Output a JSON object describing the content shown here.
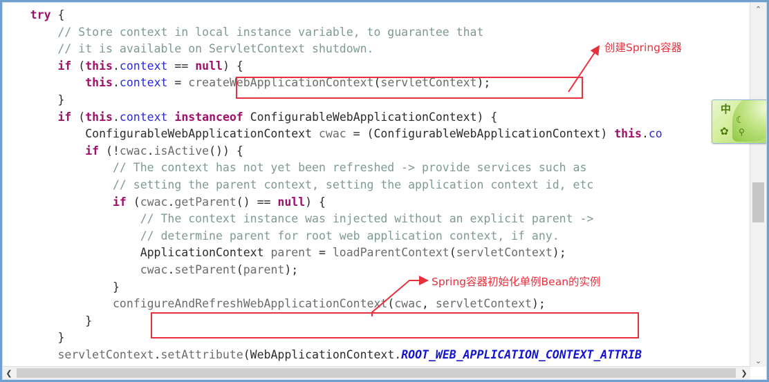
{
  "editor": {
    "language": "java",
    "code_lines": [
      {
        "id": "l1",
        "indent": 1,
        "text": "try {"
      },
      {
        "id": "l2",
        "indent": 2,
        "text": "// Store context in local instance variable, to guarantee that"
      },
      {
        "id": "l3",
        "indent": 2,
        "text": "// it is available on ServletContext shutdown."
      },
      {
        "id": "l4",
        "indent": 2,
        "text": "if (this.context == null) {"
      },
      {
        "id": "l5",
        "indent": 3,
        "text": "this.context = createWebApplicationContext(servletContext);"
      },
      {
        "id": "l6",
        "indent": 2,
        "text": "}"
      },
      {
        "id": "l7",
        "indent": 2,
        "text": "if (this.context instanceof ConfigurableWebApplicationContext) {"
      },
      {
        "id": "l8",
        "indent": 3,
        "text": "ConfigurableWebApplicationContext cwac = (ConfigurableWebApplicationContext) this.co"
      },
      {
        "id": "l9",
        "indent": 3,
        "text": "if (!cwac.isActive()) {"
      },
      {
        "id": "l10",
        "indent": 4,
        "text": "// The context has not yet been refreshed -> provide services such as"
      },
      {
        "id": "l11",
        "indent": 4,
        "text": "// setting the parent context, setting the application context id, etc"
      },
      {
        "id": "l12",
        "indent": 4,
        "text": "if (cwac.getParent() == null) {"
      },
      {
        "id": "l13",
        "indent": 5,
        "text": "// The context instance was injected without an explicit parent ->"
      },
      {
        "id": "l14",
        "indent": 5,
        "text": "// determine parent for root web application context, if any."
      },
      {
        "id": "l15",
        "indent": 5,
        "text": "ApplicationContext parent = loadParentContext(servletContext);"
      },
      {
        "id": "l16",
        "indent": 5,
        "text": "cwac.setParent(parent);"
      },
      {
        "id": "l17",
        "indent": 4,
        "text": "}"
      },
      {
        "id": "l18",
        "indent": 4,
        "text": "configureAndRefreshWebApplicationContext(cwac, servletContext);"
      },
      {
        "id": "l19",
        "indent": 3,
        "text": "}"
      },
      {
        "id": "l20",
        "indent": 2,
        "text": "}"
      },
      {
        "id": "l21",
        "indent": 2,
        "text": "servletContext.setAttribute(WebApplicationContext.ROOT_WEB_APPLICATION_CONTEXT_ATTRIB"
      }
    ]
  },
  "annotations": [
    {
      "id": "create",
      "label": "创建Spring容器",
      "color": "#e8303c",
      "targets_line": "l5"
    },
    {
      "id": "refresh",
      "label": "Spring容器初始化单例Bean的实例",
      "color": "#e8303c",
      "targets_line": "l18"
    }
  ],
  "ime": {
    "language_icon": "中",
    "moon_icon": "☾",
    "gear_icon": "✿",
    "dot_icon": "⚲"
  },
  "scrollbars": {
    "vertical": {
      "up_arrow": "⌃",
      "down_arrow": "⌄"
    },
    "horizontal": {
      "left_arrow": "❮",
      "right_arrow": "❯"
    }
  },
  "theme": {
    "keyword_color": "#a0106a",
    "field_color": "#2a2ad0",
    "comment_color": "#7f9a8e",
    "constant_color": "#1414cf",
    "annotation_color": "#e8303c",
    "frame_color": "#6f9fcd",
    "background": "#ffffff"
  }
}
